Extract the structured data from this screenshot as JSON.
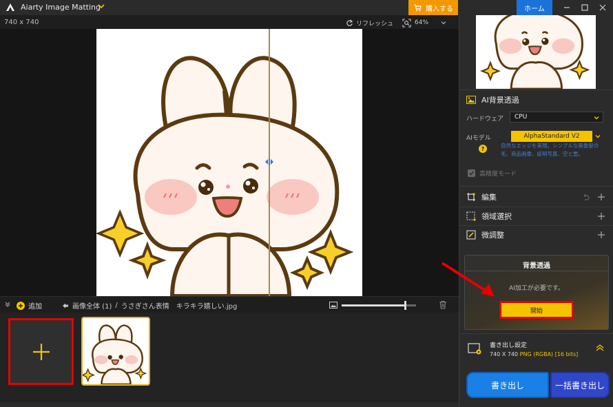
{
  "app": {
    "title": "Aiarty Image Matting",
    "buy_label": "購入する",
    "home_label": "ホーム"
  },
  "canvas": {
    "dimensions": "740 x 740",
    "refresh_label": "リフレッシュ",
    "zoom": "64%"
  },
  "bottom_bar": {
    "add_label": "追加",
    "breadcrumb_root": "画像全体 (1)",
    "separator": "/",
    "file_name": "うさぎさん表情　キラキラ嬉しい.jpg",
    "thumb_size": 0.85
  },
  "right_panel": {
    "ai_bg": {
      "title": "AI背景透過",
      "hardware_label": "ハードウェア",
      "hardware_value": "CPU",
      "model_label": "AIモデル",
      "model_value": "AlphaStandard  V2",
      "model_description": "自然なエッジを実現。シンプルな画像髪の毛、商品画像、証明写真、空と雲。",
      "hq_mode_label": "高精度モード"
    },
    "edit_label": "編集",
    "region_label": "領域選択",
    "fine_tune_label": "微調整",
    "bg_panel": {
      "title": "背景透過",
      "message": "AI加工が必要です。",
      "start_label": "開始"
    },
    "export": {
      "title": "書き出し設定",
      "dims": "740 X 740",
      "format": "PNG (RGBA) [16 bits]",
      "export_label": "書き出し",
      "batch_label": "一括書き出し"
    }
  },
  "colors": {
    "accent": "#f4c400",
    "buy": "#f39800",
    "home": "#1a73d9",
    "highlight": "#e60000"
  }
}
